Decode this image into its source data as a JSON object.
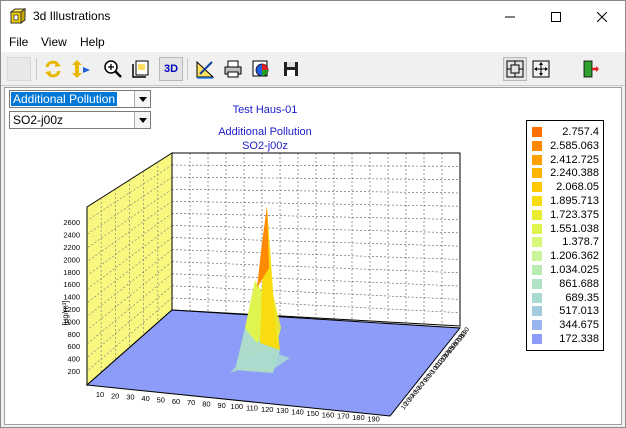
{
  "window": {
    "title": "3d Illustrations"
  },
  "menu": {
    "items": [
      "File",
      "View",
      "Help"
    ]
  },
  "toolbar": {
    "three_d_label": "3D"
  },
  "selectors": {
    "pollution_type": "Additional Pollution",
    "substance": "SO2-j00z"
  },
  "chart_data": {
    "type": "surface3d",
    "title_lines": [
      "Test Haus-01",
      "Additional Pollution",
      "SO2-j00z"
    ],
    "zlabel": "[µg/m³]",
    "z_ticks": [
      "200",
      "400",
      "600",
      "800",
      "1000",
      "1200",
      "1400",
      "1600",
      "1800",
      "2000",
      "2200",
      "2400",
      "2600"
    ],
    "x_ticks": [
      "10",
      "20",
      "30",
      "40",
      "50",
      "60",
      "70",
      "80",
      "90",
      "100",
      "110",
      "120",
      "130",
      "140",
      "150",
      "160",
      "170",
      "180",
      "190"
    ],
    "y_ticks": [
      "10",
      "20",
      "30",
      "40",
      "50",
      "60",
      "70",
      "80",
      "90",
      "100",
      "110",
      "120",
      "130",
      "140",
      "150",
      "160",
      "170",
      "180",
      "190"
    ],
    "legend": [
      {
        "label": "2.757.4",
        "color": "#ff7000"
      },
      {
        "label": "2.585.063",
        "color": "#ff8a00"
      },
      {
        "label": "2.412.725",
        "color": "#ffa000"
      },
      {
        "label": "2.240.388",
        "color": "#ffb400"
      },
      {
        "label": "2.068.05",
        "color": "#ffc800"
      },
      {
        "label": "1.895.713",
        "color": "#f8dc10"
      },
      {
        "label": "1.723.375",
        "color": "#eaec30"
      },
      {
        "label": "1.551.038",
        "color": "#e0f450"
      },
      {
        "label": "1.378.7",
        "color": "#d8f878"
      },
      {
        "label": "1.206.362",
        "color": "#c8f49a"
      },
      {
        "label": "1.034.025",
        "color": "#b8ecb0"
      },
      {
        "label": "861.688",
        "color": "#b0e4c4"
      },
      {
        "label": "689.35",
        "color": "#a8dcd0"
      },
      {
        "label": "517.013",
        "color": "#a0ccdc"
      },
      {
        "label": "344.675",
        "color": "#98b4ec"
      },
      {
        "label": "172.338",
        "color": "#8c9cf8"
      }
    ]
  }
}
